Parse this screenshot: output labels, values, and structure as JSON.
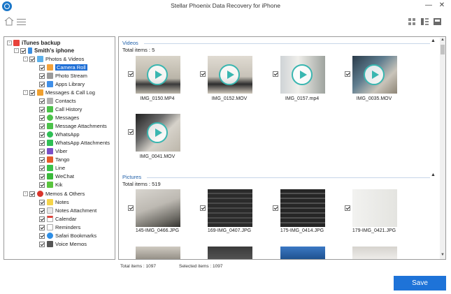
{
  "window": {
    "title": "Stellar Phoenix Data Recovery for iPhone"
  },
  "tree": {
    "root": "iTunes backup",
    "device": "Smith's iphone",
    "groups": [
      {
        "label": "Photos & Videos",
        "items": [
          "Camera Roll",
          "Photo Stream",
          "Apps Library"
        ]
      },
      {
        "label": "Messages & Call Log",
        "items": [
          "Contacts",
          "Call History",
          "Messages",
          "Message Attachments",
          "WhatsApp",
          "WhatsApp Attachments",
          "Viber",
          "Tango",
          "Line",
          "WeChat",
          "Kik"
        ]
      },
      {
        "label": "Memos & Others",
        "items": [
          "Notes",
          "Notes Attachment",
          "Calendar",
          "Reminders",
          "Safari Bookmarks",
          "Voice Memos"
        ]
      }
    ],
    "selected": "Camera Roll"
  },
  "videos": {
    "title": "Videos",
    "total": "Total items : 5",
    "files": [
      "IMG_0150.MP4",
      "IMG_0152.MOV",
      "IMG_0157.mp4",
      "IMG_0035.MOV",
      "IMG_0041.MOV"
    ]
  },
  "pictures": {
    "title": "Pictures",
    "total": "Total items : 519",
    "files": [
      "145-IMG_0466.JPG",
      "169-IMG_0407.JPG",
      "175-IMG_0414.JPG",
      "179-IMG_0421.JPG"
    ]
  },
  "footer": {
    "total_items": "Total items : 1097",
    "selected_items": "Selected items : 1097"
  },
  "actions": {
    "save_label": "Save"
  },
  "colors": {
    "accent": "#1e73d8",
    "selection": "#1f6fd6",
    "section_title": "#1f5fa8",
    "play_ring": "#39b6b0"
  },
  "icons": {
    "app_logo": "app-logo-icon",
    "home": "home-icon",
    "menu": "menu-icon",
    "views": [
      "grid-view-icon",
      "detail-view-icon",
      "preview-view-icon"
    ],
    "window_controls": [
      "minimize-icon",
      "close-icon"
    ]
  }
}
